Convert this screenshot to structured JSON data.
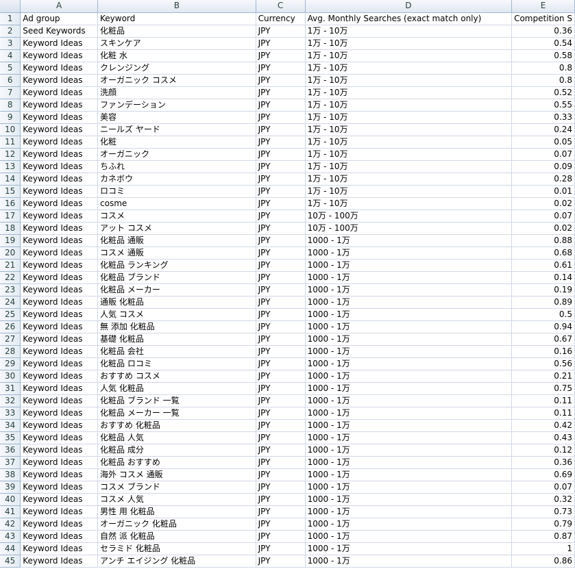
{
  "columns": [
    "A",
    "B",
    "C",
    "D",
    "E"
  ],
  "header": {
    "row": "1",
    "cells": [
      "Ad group",
      "Keyword",
      "Currency",
      "Avg. Monthly Searches (exact match only)",
      "Competition S"
    ]
  },
  "rows": [
    {
      "n": "2",
      "a": "Seed Keywords",
      "b": "化粧品",
      "c": "JPY",
      "d": "1万 - 10万",
      "e": "0.36"
    },
    {
      "n": "3",
      "a": "Keyword Ideas",
      "b": "スキンケア",
      "c": "JPY",
      "d": "1万 - 10万",
      "e": "0.54"
    },
    {
      "n": "4",
      "a": "Keyword Ideas",
      "b": "化粧 水",
      "c": "JPY",
      "d": "1万 - 10万",
      "e": "0.58"
    },
    {
      "n": "5",
      "a": "Keyword Ideas",
      "b": "クレンジング",
      "c": "JPY",
      "d": "1万 - 10万",
      "e": "0.8"
    },
    {
      "n": "6",
      "a": "Keyword Ideas",
      "b": "オーガニック コスメ",
      "c": "JPY",
      "d": "1万 - 10万",
      "e": "0.8"
    },
    {
      "n": "7",
      "a": "Keyword Ideas",
      "b": "洗顔",
      "c": "JPY",
      "d": "1万 - 10万",
      "e": "0.52"
    },
    {
      "n": "8",
      "a": "Keyword Ideas",
      "b": "ファンデーション",
      "c": "JPY",
      "d": "1万 - 10万",
      "e": "0.55"
    },
    {
      "n": "9",
      "a": "Keyword Ideas",
      "b": "美容",
      "c": "JPY",
      "d": "1万 - 10万",
      "e": "0.33"
    },
    {
      "n": "10",
      "a": "Keyword Ideas",
      "b": "ニールズ ヤード",
      "c": "JPY",
      "d": "1万 - 10万",
      "e": "0.24"
    },
    {
      "n": "11",
      "a": "Keyword Ideas",
      "b": "化粧",
      "c": "JPY",
      "d": "1万 - 10万",
      "e": "0.05"
    },
    {
      "n": "12",
      "a": "Keyword Ideas",
      "b": "オーガニック",
      "c": "JPY",
      "d": "1万 - 10万",
      "e": "0.07"
    },
    {
      "n": "13",
      "a": "Keyword Ideas",
      "b": "ちふれ",
      "c": "JPY",
      "d": "1万 - 10万",
      "e": "0.09"
    },
    {
      "n": "14",
      "a": "Keyword Ideas",
      "b": "カネボウ",
      "c": "JPY",
      "d": "1万 - 10万",
      "e": "0.28"
    },
    {
      "n": "15",
      "a": "Keyword Ideas",
      "b": "ロコミ",
      "c": "JPY",
      "d": "1万 - 10万",
      "e": "0.01"
    },
    {
      "n": "16",
      "a": "Keyword Ideas",
      "b": "cosme",
      "c": "JPY",
      "d": "1万 - 10万",
      "e": "0.02"
    },
    {
      "n": "17",
      "a": "Keyword Ideas",
      "b": "コスメ",
      "c": "JPY",
      "d": "10万 - 100万",
      "e": "0.07"
    },
    {
      "n": "18",
      "a": "Keyword Ideas",
      "b": "アット コスメ",
      "c": "JPY",
      "d": "10万 - 100万",
      "e": "0.02"
    },
    {
      "n": "19",
      "a": "Keyword Ideas",
      "b": "化粧品 通販",
      "c": "JPY",
      "d": "1000 - 1万",
      "e": "0.88"
    },
    {
      "n": "20",
      "a": "Keyword Ideas",
      "b": "コスメ 通販",
      "c": "JPY",
      "d": "1000 - 1万",
      "e": "0.68"
    },
    {
      "n": "21",
      "a": "Keyword Ideas",
      "b": "化粧品 ランキング",
      "c": "JPY",
      "d": "1000 - 1万",
      "e": "0.61"
    },
    {
      "n": "22",
      "a": "Keyword Ideas",
      "b": "化粧品 ブランド",
      "c": "JPY",
      "d": "1000 - 1万",
      "e": "0.14"
    },
    {
      "n": "23",
      "a": "Keyword Ideas",
      "b": "化粧品 メーカー",
      "c": "JPY",
      "d": "1000 - 1万",
      "e": "0.19"
    },
    {
      "n": "24",
      "a": "Keyword Ideas",
      "b": "通販 化粧品",
      "c": "JPY",
      "d": "1000 - 1万",
      "e": "0.89"
    },
    {
      "n": "25",
      "a": "Keyword Ideas",
      "b": "人気 コスメ",
      "c": "JPY",
      "d": "1000 - 1万",
      "e": "0.5"
    },
    {
      "n": "26",
      "a": "Keyword Ideas",
      "b": "無 添加 化粧品",
      "c": "JPY",
      "d": "1000 - 1万",
      "e": "0.94"
    },
    {
      "n": "27",
      "a": "Keyword Ideas",
      "b": "基礎 化粧品",
      "c": "JPY",
      "d": "1000 - 1万",
      "e": "0.67"
    },
    {
      "n": "28",
      "a": "Keyword Ideas",
      "b": "化粧品 会社",
      "c": "JPY",
      "d": "1000 - 1万",
      "e": "0.16"
    },
    {
      "n": "29",
      "a": "Keyword Ideas",
      "b": "化粧品 ロコミ",
      "c": "JPY",
      "d": "1000 - 1万",
      "e": "0.56"
    },
    {
      "n": "30",
      "a": "Keyword Ideas",
      "b": "おすすめ コスメ",
      "c": "JPY",
      "d": "1000 - 1万",
      "e": "0.21"
    },
    {
      "n": "31",
      "a": "Keyword Ideas",
      "b": "人気 化粧品",
      "c": "JPY",
      "d": "1000 - 1万",
      "e": "0.75"
    },
    {
      "n": "32",
      "a": "Keyword Ideas",
      "b": "化粧品 ブランド 一覧",
      "c": "JPY",
      "d": "1000 - 1万",
      "e": "0.11"
    },
    {
      "n": "33",
      "a": "Keyword Ideas",
      "b": "化粧品 メーカー 一覧",
      "c": "JPY",
      "d": "1000 - 1万",
      "e": "0.11"
    },
    {
      "n": "34",
      "a": "Keyword Ideas",
      "b": "おすすめ 化粧品",
      "c": "JPY",
      "d": "1000 - 1万",
      "e": "0.42"
    },
    {
      "n": "35",
      "a": "Keyword Ideas",
      "b": "化粧品 人気",
      "c": "JPY",
      "d": "1000 - 1万",
      "e": "0.43"
    },
    {
      "n": "36",
      "a": "Keyword Ideas",
      "b": "化粧品 成分",
      "c": "JPY",
      "d": "1000 - 1万",
      "e": "0.12"
    },
    {
      "n": "37",
      "a": "Keyword Ideas",
      "b": "化粧品 おすすめ",
      "c": "JPY",
      "d": "1000 - 1万",
      "e": "0.36"
    },
    {
      "n": "38",
      "a": "Keyword Ideas",
      "b": "海外 コスメ 通販",
      "c": "JPY",
      "d": "1000 - 1万",
      "e": "0.69"
    },
    {
      "n": "39",
      "a": "Keyword Ideas",
      "b": "コスメ ブランド",
      "c": "JPY",
      "d": "1000 - 1万",
      "e": "0.07"
    },
    {
      "n": "40",
      "a": "Keyword Ideas",
      "b": "コスメ 人気",
      "c": "JPY",
      "d": "1000 - 1万",
      "e": "0.32"
    },
    {
      "n": "41",
      "a": "Keyword Ideas",
      "b": "男性 用 化粧品",
      "c": "JPY",
      "d": "1000 - 1万",
      "e": "0.73"
    },
    {
      "n": "42",
      "a": "Keyword Ideas",
      "b": "オーガニック 化粧品",
      "c": "JPY",
      "d": "1000 - 1万",
      "e": "0.79"
    },
    {
      "n": "43",
      "a": "Keyword Ideas",
      "b": "自然 派 化粧品",
      "c": "JPY",
      "d": "1000 - 1万",
      "e": "0.87"
    },
    {
      "n": "44",
      "a": "Keyword Ideas",
      "b": "セラミド 化粧品",
      "c": "JPY",
      "d": "1000 - 1万",
      "e": "1"
    },
    {
      "n": "45",
      "a": "Keyword Ideas",
      "b": "アンチ エイジング 化粧品",
      "c": "JPY",
      "d": "1000 - 1万",
      "e": "0.86"
    }
  ]
}
